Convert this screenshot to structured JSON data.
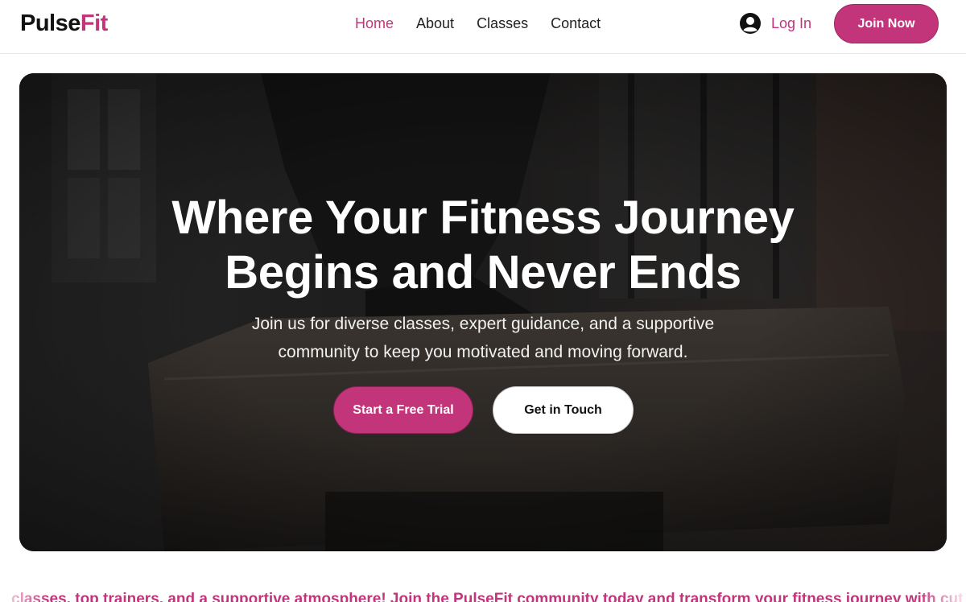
{
  "header": {
    "logo_part1": "Pulse",
    "logo_part2": "Fit",
    "nav": [
      {
        "label": "Home",
        "active": true
      },
      {
        "label": "About"
      },
      {
        "label": "Classes"
      },
      {
        "label": "Contact"
      }
    ],
    "login_label": "Log In",
    "join_label": "Join Now"
  },
  "hero": {
    "title_line1": "Where Your Fitness Journey",
    "title_line2": "Begins and Never Ends",
    "subtitle_line1": "Join us for diverse classes, expert guidance, and a supportive",
    "subtitle_line2": "community to keep you motivated and moving forward.",
    "primary_button": "Start a Free Trial",
    "secondary_button": "Get in Touch"
  },
  "marquee": {
    "text": "classes, top trainers, and a supportive atmosphere!   Join the PulseFit community today and transform your fitness journey with cut"
  },
  "colors": {
    "brand": "#c2357a",
    "text": "#111111",
    "white": "#ffffff"
  },
  "icons": {
    "login": "user-avatar-icon"
  }
}
